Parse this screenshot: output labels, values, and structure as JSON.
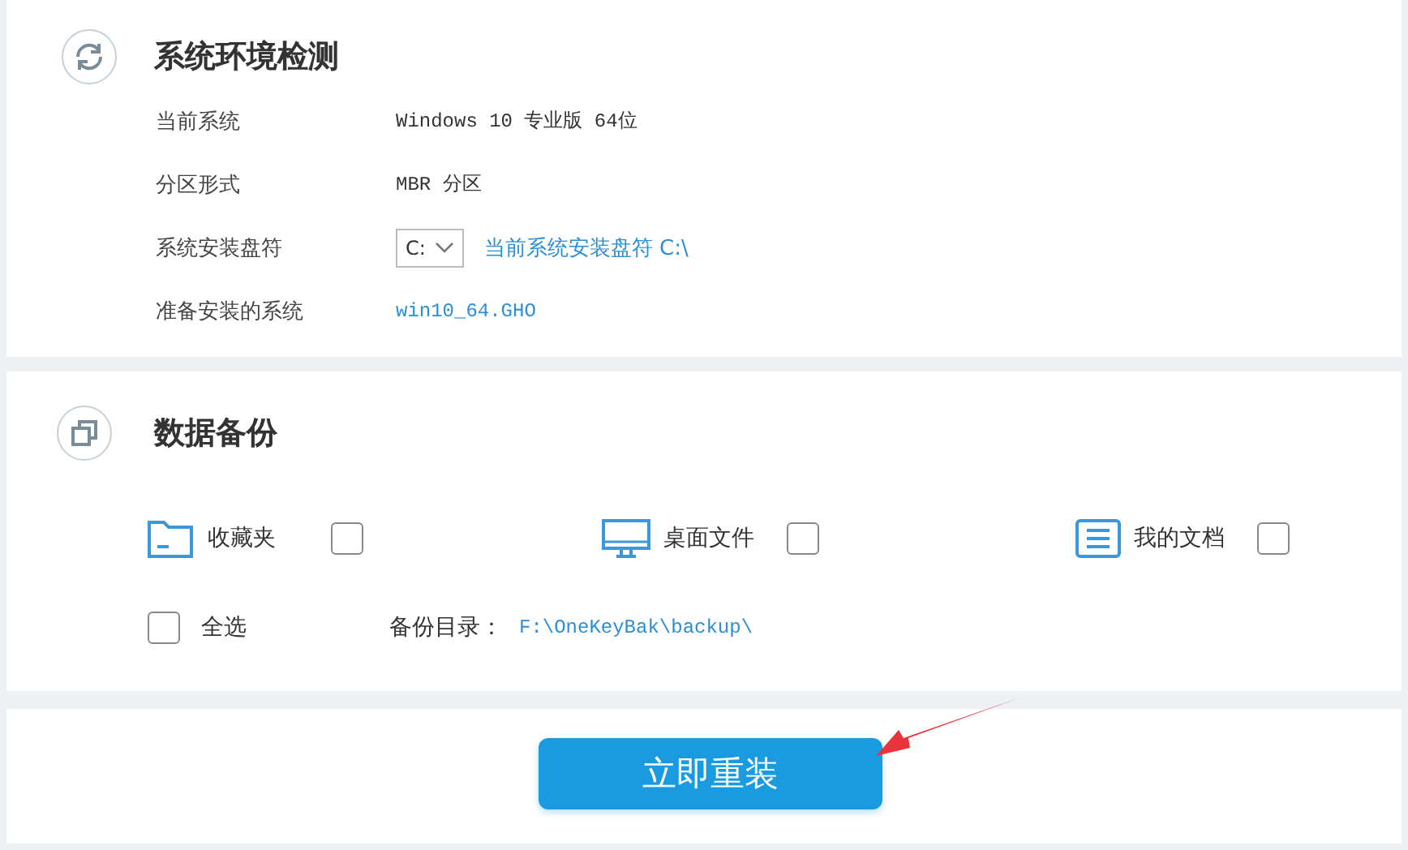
{
  "system_check": {
    "title": "系统环境检测",
    "rows": [
      {
        "kind": "text",
        "label": "当前系统",
        "value": "Windows 10 专业版 64位"
      },
      {
        "kind": "text",
        "label": "分区形式",
        "value": "MBR 分区"
      },
      {
        "kind": "select",
        "label": "系统安装盘符",
        "value": "C:",
        "note": "当前系统安装盘符 C:\\"
      },
      {
        "kind": "link",
        "label": "准备安装的系统",
        "value": "win10_64.GHO"
      }
    ]
  },
  "data_backup": {
    "title": "数据备份",
    "items": [
      {
        "kind": "folder",
        "label": "收藏夹",
        "checked": false
      },
      {
        "kind": "desktop",
        "label": "桌面文件",
        "checked": false
      },
      {
        "kind": "documents",
        "label": "我的文档",
        "checked": false
      }
    ],
    "select_all": {
      "label": "全选",
      "checked": false
    },
    "directory_label": "备份目录：",
    "directory": "F:\\OneKeyBak\\backup\\"
  },
  "action": {
    "button": "立即重装"
  }
}
